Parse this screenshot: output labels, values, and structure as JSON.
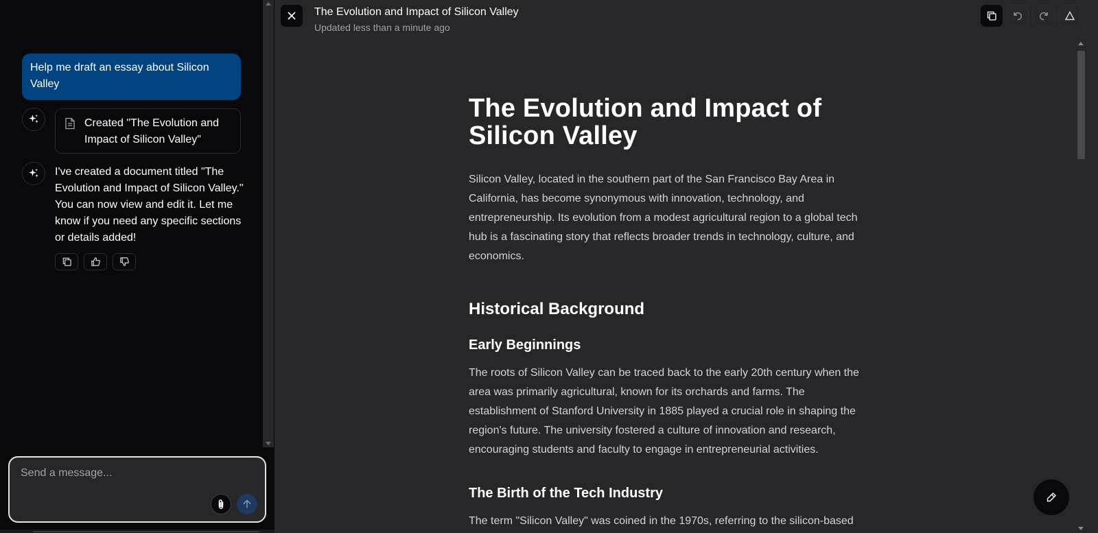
{
  "chat": {
    "user_message": "Help me draft an essay about Silicon Valley",
    "doc_card_label": "Created \"The Evolution and Impact of Silicon Valley\"",
    "assistant_message": "I've created a document titled \"The Evolution and Impact of Silicon Valley.\" You can now view and edit it. Let me know if you need any specific sections or details added!",
    "composer_placeholder": "Send a message...",
    "icons": {
      "assistant_avatar": "sparkles-icon",
      "doc_card": "file-text-icon",
      "copy": "copy-icon",
      "thumbs_up": "thumbs-up-icon",
      "thumbs_down": "thumbs-down-icon",
      "attach": "paperclip-icon",
      "send": "arrow-up-icon"
    }
  },
  "document": {
    "header_title": "The Evolution and Impact of Silicon Valley",
    "updated_text": "Updated less than a minute ago",
    "title": "The Evolution and Impact of Silicon Valley",
    "intro": "Silicon Valley, located in the southern part of the San Francisco Bay Area in California, has become synonymous with innovation, technology, and entrepreneurship. Its evolution from a modest agricultural region to a global tech hub is a fascinating story that reflects broader trends in technology, culture, and economics.",
    "section1_heading": "Historical Background",
    "subsection1_heading": "Early Beginnings",
    "subsection1_text": "The roots of Silicon Valley can be traced back to the early 20th century when the area was primarily agricultural, known for its orchards and farms. The establishment of Stanford University in 1885 played a crucial role in shaping the region's future. The university fostered a culture of innovation and research, encouraging students and faculty to engage in entrepreneurial activities.",
    "subsection2_heading": "The Birth of the Tech Industry",
    "subsection2_text": "The term \"Silicon Valley\" was coined in the 1970s, referring to the silicon-based",
    "toolbar_icons": [
      "copy-icon",
      "undo-icon",
      "redo-icon",
      "delta-icon"
    ],
    "icons": {
      "close": "close-icon",
      "edit": "pencil-icon"
    }
  },
  "colors": {
    "user_bubble": "#014380",
    "chat_bg": "#09090b",
    "doc_bg": "#27272a"
  }
}
